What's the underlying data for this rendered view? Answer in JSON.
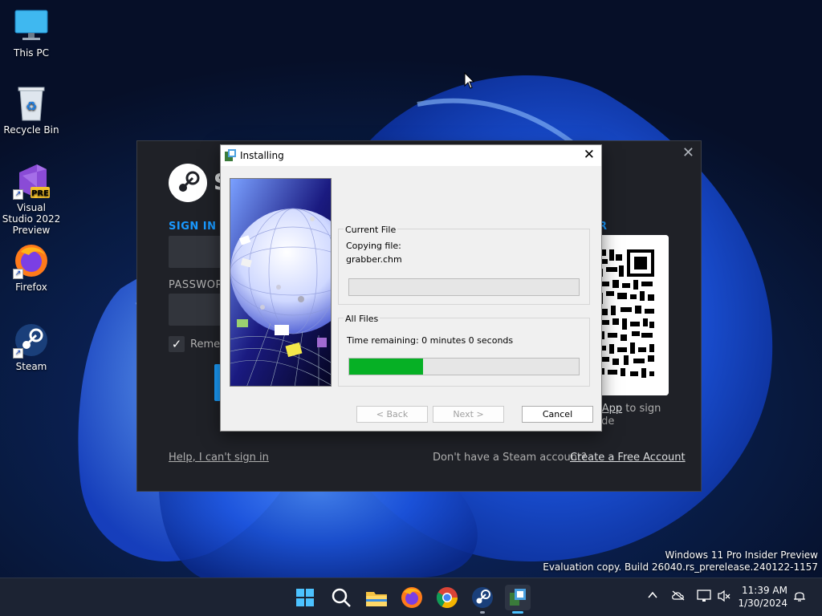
{
  "desktop": {
    "icons": [
      {
        "label": "This PC"
      },
      {
        "label": "Recycle Bin"
      },
      {
        "label": "Visual Studio 2022 Preview",
        "badge": "PRE"
      },
      {
        "label": "Firefox"
      },
      {
        "label": "Steam"
      }
    ],
    "watermark": {
      "line1": "Windows 11 Pro Insider Preview",
      "line2": "Evaluation copy. Build 26040.rs_prerelease.240122-1157"
    }
  },
  "steam": {
    "brand_initial": "S",
    "sign_in_label": "SIGN IN WI",
    "password_label": "PASSWORD",
    "remember_label": "Remem",
    "qr_label_fragment": "R",
    "mobile_line1_link": "le App",
    "mobile_line1_rest": " to sign",
    "mobile_line2": "code",
    "help_link": "Help, I can't sign in",
    "no_account_text": "Don't have a Steam account?",
    "create_link": "Create a Free Account",
    "close_glyph": "✕"
  },
  "installer": {
    "title": "Installing",
    "close_glyph": "✕",
    "current_file": {
      "title": "Current File",
      "line1": "Copying file:",
      "line2": "grabber.chm",
      "progress": 0
    },
    "all_files": {
      "title": "All Files",
      "time_remaining": "Time remaining: 0 minutes 0 seconds",
      "progress": 0.32
    },
    "buttons": {
      "back": "< Back",
      "next": "Next >",
      "cancel": "Cancel"
    }
  },
  "taskbar": {
    "apps": [
      "start-icon",
      "search-icon",
      "file-explorer-icon",
      "firefox-icon",
      "chrome-icon",
      "steam-icon",
      "installer-icon"
    ],
    "clock": {
      "time": "11:39 AM",
      "date": "1/30/2024"
    }
  },
  "colors": {
    "progress_green": "#06b025",
    "steam_blue": "#1999ff",
    "steam_bg": "#1f2127"
  }
}
